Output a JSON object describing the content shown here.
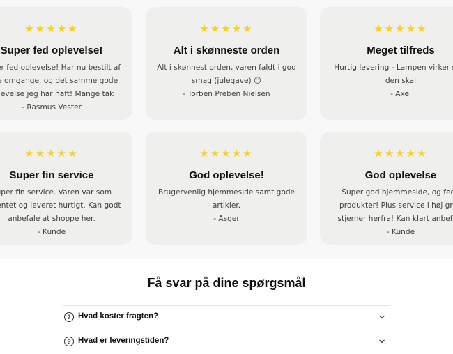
{
  "reviews": [
    {
      "stars": "★★★★★",
      "title": "Super fed oplevelse!",
      "lines": [
        "Super fed oplevelse! Har nu bestilt af",
        "flere omgange, og det samme gode",
        "oplevelse jeg har haft! Mange tak",
        "- Rasmus Vester"
      ]
    },
    {
      "stars": "★★★★★",
      "title": "Alt i skønneste orden",
      "lines": [
        "Alt i skønnest orden, varen faldt i god",
        "smag (julegave) 😊",
        "- Torben Preben Nielsen"
      ]
    },
    {
      "stars": "★★★★★",
      "title": "Meget tilfreds",
      "lines": [
        "Hurtig levering - Lampen virker som",
        "den skal",
        "- Axel"
      ]
    },
    {
      "stars": "★★★★★",
      "title": "Super fin service",
      "lines": [
        "Super fin service. Varen var som",
        "forventet og leveret hurtigt. Kan godt",
        "anbefale at shoppe her.",
        "- Kunde"
      ]
    },
    {
      "stars": "★★★★★",
      "title": "God oplevelse!",
      "lines": [
        "Brugervenlig hjemmeside samt gode",
        "artikler.",
        "- Asger"
      ]
    },
    {
      "stars": "★★★★★",
      "title": "God oplevelse",
      "lines": [
        "Super god hjemmeside, og fede",
        "produkter! Plus service i høj grad",
        "stjerner herfra! Kan klart anbefale",
        "- Kunde"
      ]
    }
  ],
  "faq": {
    "title": "Få svar på dine spørgsmål",
    "questions": [
      "Hvad koster fragten?",
      "Hvad er leveringstiden?"
    ]
  },
  "colors": {
    "star": "#f5cf22",
    "card_bg": "#efefed"
  },
  "icons": {
    "question": "question-circle-icon",
    "expand": "chevron-down-icon"
  }
}
